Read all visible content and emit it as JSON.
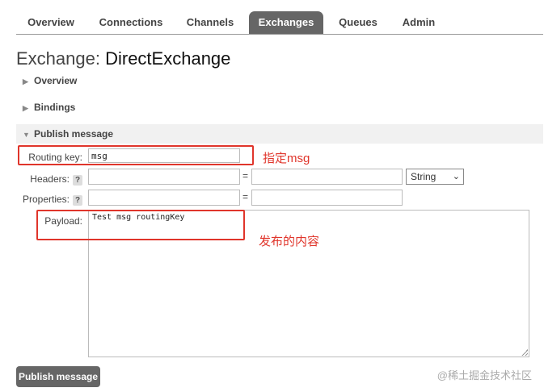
{
  "nav": {
    "tabs": [
      "Overview",
      "Connections",
      "Channels",
      "Exchanges",
      "Queues",
      "Admin"
    ],
    "active_index": 3
  },
  "page": {
    "title_prefix": "Exchange:",
    "title_name": "DirectExchange"
  },
  "sections": {
    "overview": "Overview",
    "bindings": "Bindings",
    "publish": "Publish message"
  },
  "form": {
    "routing_key_label": "Routing key:",
    "routing_key_value": "msg",
    "headers_label": "Headers:",
    "properties_label": "Properties:",
    "help_glyph": "?",
    "equals": "=",
    "type_select_value": "String",
    "payload_label": "Payload:",
    "payload_value": "Test msg  routingKey"
  },
  "annotations": {
    "routing_note": "指定msg",
    "payload_note": "发布的内容",
    "color": "#e0352b"
  },
  "actions": {
    "publish_button": "Publish message"
  },
  "watermark": "@稀土掘金技术社区"
}
